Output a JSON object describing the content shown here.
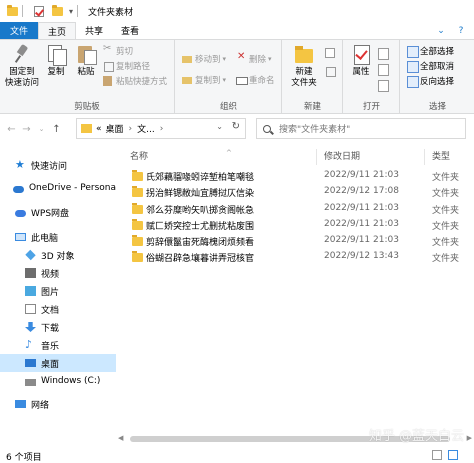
{
  "window": {
    "title": "文件夹素材"
  },
  "ribbon": {
    "tabs": [
      "文件",
      "主页",
      "共享",
      "查看"
    ],
    "clipboard": {
      "pin_label": "固定到\n快速访问",
      "copy_label": "复制",
      "paste_label": "粘贴",
      "cut_label": "剪切",
      "copy_path_label": "复制路径",
      "paste_shortcut_label": "粘贴快捷方式",
      "group_label": "剪贴板"
    },
    "organize": {
      "move_to_label": "移动到",
      "copy_to_label": "复制到",
      "delete_label": "删除",
      "rename_label": "重命名",
      "group_label": "组织"
    },
    "new": {
      "new_folder_label": "新建\n文件夹",
      "group_label": "新建"
    },
    "open": {
      "properties_label": "属性",
      "group_label": "打开"
    },
    "select": {
      "select_all_label": "全部选择",
      "select_none_label": "全部取消",
      "invert_label": "反向选择",
      "group_label": "选择"
    }
  },
  "address": {
    "prefix": "«",
    "crumb1": "桌面",
    "crumb2": "文...",
    "search_placeholder": "搜索\"文件夹素材\""
  },
  "nav_pane": {
    "items": [
      {
        "label": "快速访问",
        "icon": "star-icon"
      },
      {
        "label": "OneDrive - Persona",
        "icon": "onedrive-icon"
      },
      {
        "label": "WPS网盘",
        "icon": "wps-cloud-icon"
      },
      {
        "label": "此电脑",
        "icon": "pc-icon"
      },
      {
        "label": "3D 对象",
        "icon": "3d-objects-icon"
      },
      {
        "label": "视频",
        "icon": "video-icon"
      },
      {
        "label": "图片",
        "icon": "pictures-icon"
      },
      {
        "label": "文档",
        "icon": "documents-icon"
      },
      {
        "label": "下载",
        "icon": "download-icon"
      },
      {
        "label": "音乐",
        "icon": "music-icon"
      },
      {
        "label": "桌面",
        "icon": "desktop-icon"
      },
      {
        "label": "Windows (C:)",
        "icon": "drive-icon"
      },
      {
        "label": "网络",
        "icon": "network-icon"
      }
    ]
  },
  "columns": {
    "name": "名称",
    "date": "修改日期",
    "type": "类型"
  },
  "files": [
    {
      "name": "氏郊藕骝喙蚓谇堑柏笔嘲毯",
      "date": "2022/9/11 21:03",
      "type": "文件夹"
    },
    {
      "name": "拐治鲜锶敝灿宜膊挝仄信染",
      "date": "2022/9/12 17:08",
      "type": "文件夹"
    },
    {
      "name": "邻么芬糜哟矢叭掷贪阁帐急",
      "date": "2022/9/11 21:03",
      "type": "文件夹"
    },
    {
      "name": "赋匚娇突控士尤删扰粘废围",
      "date": "2022/9/11 21:03",
      "type": "文件夹"
    },
    {
      "name": "剪辞儇鬣宙死酶槐闭烦频看",
      "date": "2022/9/11 21:03",
      "type": "文件夹"
    },
    {
      "name": "俗蝴召辟急壤暮讲弄冠核官",
      "date": "2022/9/12 13:43",
      "type": "文件夹"
    }
  ],
  "status": {
    "item_count": "6 个项目"
  },
  "watermark": "知乎 @蓝天白云"
}
